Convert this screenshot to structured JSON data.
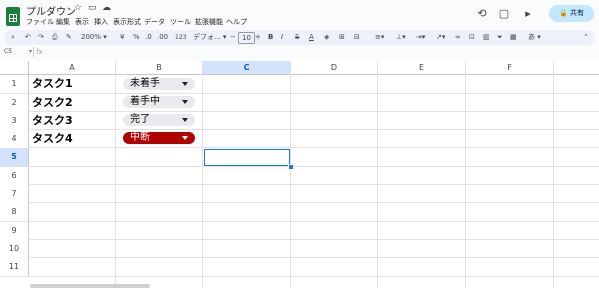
{
  "app": {
    "title": "プルダウン"
  },
  "menu": [
    "ファイル",
    "編集",
    "表示",
    "挿入",
    "表示形式",
    "データ",
    "ツール",
    "拡張機能",
    "ヘルプ"
  ],
  "share_label": "共有",
  "toolbar": {
    "zoom": "200%",
    "percent": "%",
    "decimal": ".0",
    "decimal2": ".00",
    "number_format": "123",
    "font": "デフォ...",
    "font_size": "10",
    "minus": "−",
    "plus": "+",
    "bold": "B",
    "italic": "I",
    "strike": "S",
    "text_color": "A",
    "input_mode": "あ"
  },
  "namebox": "C5",
  "fx": "fx",
  "columns": [
    "A",
    "B",
    "C",
    "D",
    "E",
    "F"
  ],
  "rows": [
    "1",
    "2",
    "3",
    "4",
    "5",
    "6",
    "7",
    "8",
    "9",
    "10",
    "11"
  ],
  "selected": {
    "column": "C",
    "row": "5"
  },
  "cells": {
    "A": [
      "タスク1",
      "タスク2",
      "タスク3",
      "タスク4"
    ],
    "B": [
      "未着手",
      "着手中",
      "完了",
      "中断"
    ]
  },
  "colors": {
    "accent": "#1a73e8",
    "chip": "#e8eaed",
    "chip_red": "#b10202",
    "share": "#c2e7ff"
  }
}
